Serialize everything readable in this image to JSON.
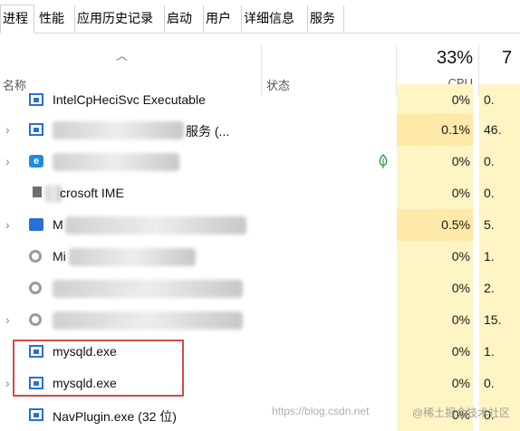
{
  "tabs": [
    "进程",
    "性能",
    "应用历史记录",
    "启动",
    "用户",
    "详细信息",
    "服务"
  ],
  "header": {
    "name_col": "名称",
    "status_col": "状态",
    "cpu_total": "33%",
    "cpu_label": "CPU",
    "mem_total": "7"
  },
  "rows": [
    {
      "expander": "",
      "icon": "window-icon",
      "name": "IntelCpHeciSvc Executable",
      "cpu": "0%",
      "mem": "0.",
      "status_icon": ""
    },
    {
      "expander": "›",
      "icon": "window-icon",
      "name": "服务 (...",
      "cpu": "0.1%",
      "mem": "46.",
      "status_icon": ""
    },
    {
      "expander": "›",
      "icon": "edge-icon",
      "name": "",
      "cpu": "0%",
      "mem": "0.",
      "status_icon": "leaf-icon"
    },
    {
      "expander": "",
      "icon": "small-app-icon",
      "name": "crosoft IME",
      "cpu": "0%",
      "mem": "0.",
      "status_icon": ""
    },
    {
      "expander": "›",
      "icon": "keyboard-icon",
      "name": "M",
      "cpu": "0.5%",
      "mem": "5.",
      "status_icon": ""
    },
    {
      "expander": "",
      "icon": "gear-icon",
      "name": "Mi",
      "cpu": "0%",
      "mem": "1.",
      "status_icon": ""
    },
    {
      "expander": "",
      "icon": "gear-icon",
      "name": "",
      "cpu": "0%",
      "mem": "2.",
      "status_icon": ""
    },
    {
      "expander": "›",
      "icon": "gear-icon",
      "name": "",
      "cpu": "0%",
      "mem": "15.",
      "status_icon": ""
    },
    {
      "expander": "",
      "icon": "window-icon",
      "name": "mysqld.exe",
      "cpu": "0%",
      "mem": "1.",
      "status_icon": ""
    },
    {
      "expander": "›",
      "icon": "window-icon",
      "name": "mysqld.exe",
      "cpu": "0%",
      "mem": "0.",
      "status_icon": ""
    },
    {
      "expander": "",
      "icon": "window-icon",
      "name": "NavPlugin.exe (32 位)",
      "cpu": "0%",
      "mem": "0.",
      "status_icon": ""
    }
  ],
  "watermark": "https://blog.csdn.net",
  "watermark_brand": "@稀土掘金技术社区"
}
